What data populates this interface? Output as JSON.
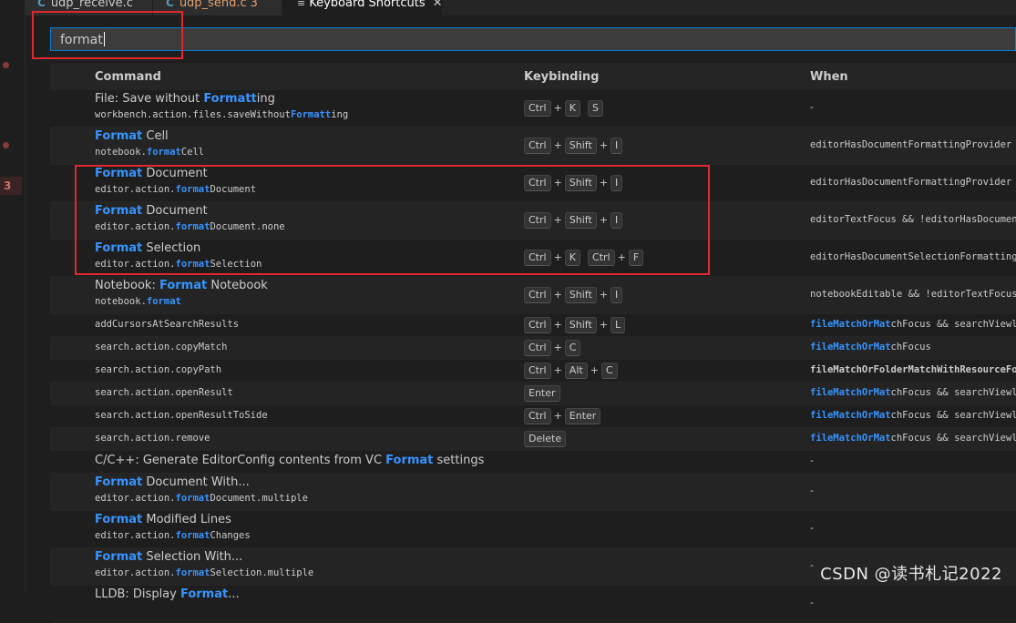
{
  "tabs": [
    {
      "label": "udp_receive.c",
      "modified": "",
      "active": false
    },
    {
      "label": "udp_send.c",
      "modified": "3",
      "active": false
    },
    {
      "label": "Keyboard Shortcuts",
      "modified": "",
      "active": true
    }
  ],
  "gutter": {
    "error_count": "3"
  },
  "search": {
    "value": "format"
  },
  "columns": {
    "command": "Command",
    "keybinding": "Keybinding",
    "when": "When"
  },
  "rows": [
    {
      "title_pre": "File: Save without ",
      "title_hl": "Formatt",
      "title_post": "ing",
      "id_pre": "workbench.action.files.saveWithout",
      "id_hl": "Formatt",
      "id_post": "ing",
      "when": "-"
    },
    {
      "title_pre": "",
      "title_hl": "Format",
      "title_post": " Cell",
      "id_pre": "notebook.",
      "id_hl": "format",
      "id_post": "Cell",
      "when": "editorHasDocumentFormattingProvider && "
    },
    {
      "title_pre": "",
      "title_hl": "Format",
      "title_post": " Document",
      "id_pre": "editor.action.",
      "id_hl": "format",
      "id_post": "Document",
      "when": "editorHasDocumentFormattingProvider && "
    },
    {
      "title_pre": "",
      "title_hl": "Format",
      "title_post": " Document",
      "id_pre": "editor.action.",
      "id_hl": "format",
      "id_post": "Document.none",
      "when": "editorTextFocus && !editorHasDocumentFo"
    },
    {
      "title_pre": "",
      "title_hl": "Format",
      "title_post": " Selection",
      "id_pre": "editor.action.",
      "id_hl": "format",
      "id_post": "Selection",
      "when": "editorHasDocumentSelectionFormattingPro"
    },
    {
      "title_pre": "Notebook: ",
      "title_hl": "Format",
      "title_post": " Notebook",
      "id_pre": "notebook.",
      "id_hl": "format",
      "id_post": "",
      "when": "notebookEditable && !editorTextFocus &&"
    },
    {
      "cmd": "addCursorsAtSearchResults",
      "when_hl1": "fileMatch",
      "when_hl2": "Or",
      "when_mid": "Mat",
      "when_post": "chFocus && searchViewletV"
    },
    {
      "cmd": "search.action.copyMatch",
      "when_hl1": "fileMatch",
      "when_hl2": "Or",
      "when_mid": "Mat",
      "when_post": "chFocus"
    },
    {
      "cmd": "search.action.copyPath",
      "when_text": "fileMatchOrFolderMatchWithResourceFocus"
    },
    {
      "cmd": "search.action.openResult",
      "when_hl1": "fileMatch",
      "when_hl2": "Or",
      "when_mid": "Mat",
      "when_post": "chFocus && searchViewletV"
    },
    {
      "cmd": "search.action.openResultToSide",
      "when_hl1": "fileMatch",
      "when_hl2": "Or",
      "when_mid": "Mat",
      "when_post": "chFocus && searchViewletV"
    },
    {
      "cmd": "search.action.remove",
      "when_hl1": "fileMatch",
      "when_hl2": "Or",
      "when_mid": "Mat",
      "when_post": "chFocus && searchViewletV"
    },
    {
      "title_pre": "C/C++: Generate EditorConfig contents from VC ",
      "title_hl": "Format",
      "title_post": " settings",
      "when": "-"
    },
    {
      "title_pre": "",
      "title_hl": "Format",
      "title_post": " Document With...",
      "id_pre": "editor.action.",
      "id_hl": "format",
      "id_post": "Document.multiple",
      "when": "-"
    },
    {
      "title_pre": "",
      "title_hl": "Format",
      "title_post": " Modified Lines",
      "id_pre": "editor.action.",
      "id_hl": "format",
      "id_post": "Changes",
      "when": "-"
    },
    {
      "title_pre": "",
      "title_hl": "Format",
      "title_post": " Selection With...",
      "id_pre": "editor.action.",
      "id_hl": "format",
      "id_post": "Selection.multiple",
      "when": "-"
    },
    {
      "title_pre": "LLDB: Display ",
      "title_hl": "Format",
      "title_post": "...",
      "when": "-"
    }
  ],
  "keys": {
    "ctrl": "Ctrl",
    "shift": "Shift",
    "alt": "Alt",
    "enter": "Enter",
    "delete": "Delete",
    "k": "K",
    "s": "S",
    "i": "I",
    "f": "F",
    "l": "L",
    "c": "C",
    "plus": "+"
  },
  "watermark": "CSDN @读书札记2022"
}
